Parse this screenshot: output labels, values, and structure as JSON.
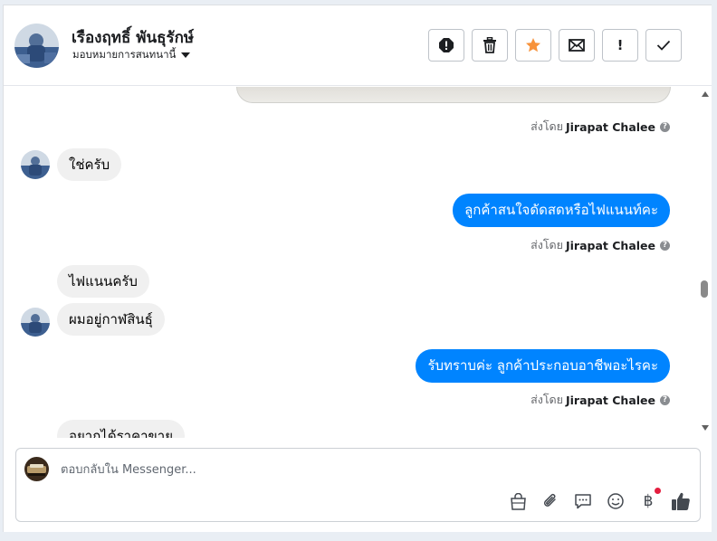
{
  "header": {
    "contact_name": "เรืองฤทธิ์ พันธุรักษ์",
    "assign_label": "มอบหมายการสนทนานี้",
    "tools": [
      {
        "icon": "report-icon"
      },
      {
        "icon": "trash-icon"
      },
      {
        "icon": "star-icon",
        "color": "#f7923b"
      },
      {
        "icon": "mail-icon"
      },
      {
        "icon": "exclamation-icon",
        "label": "!"
      },
      {
        "icon": "check-icon"
      }
    ]
  },
  "conversation": {
    "sent_by_prefix": "ส่งโดย",
    "sent_by_name": "Jirapat Chalee",
    "help_glyph": "?",
    "messages": [
      {
        "from": "customer",
        "text": "ใช่ครับ"
      },
      {
        "from": "page",
        "text": "ลูกค้าสนใจดัดสดหรือไฟแนนท์คะ"
      },
      {
        "from": "customer",
        "text": "ไฟแนนครับ"
      },
      {
        "from": "customer",
        "text": "ผมอยู่กาฬสินธุ์"
      },
      {
        "from": "page",
        "text": "รับทราบค่ะ ลูกค้าประกอบอาชีพอะไรคะ"
      },
      {
        "from": "customer",
        "text": "อยากได้ราคาขาย"
      }
    ]
  },
  "composer": {
    "placeholder": "ตอบกลับใน Messenger...",
    "value": "",
    "icons": [
      "shopping-bag-icon",
      "paperclip-icon",
      "saved-reply-icon",
      "emoji-icon",
      "baht-icon",
      "thumbs-up-icon"
    ],
    "baht_glyph": "฿"
  },
  "colors": {
    "outgoing_bubble": "#0084ff",
    "incoming_bubble": "#f0f0f0",
    "star": "#f7923b",
    "notification_dot": "#e41e3f"
  }
}
